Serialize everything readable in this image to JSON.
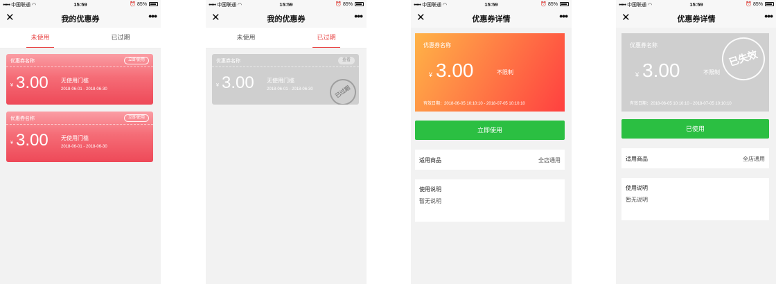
{
  "status_bar": {
    "carrier": "中国联通",
    "time": "15:59",
    "battery": "85%"
  },
  "screens": [
    {
      "nav_title": "我的优惠券",
      "tabs": [
        "未使用",
        "已过期"
      ],
      "active_tab": 0,
      "coupons": [
        {
          "name": "优惠券名称",
          "button": "立即使用",
          "currency": "¥",
          "amount": "3.00",
          "condition": "无使用门槛",
          "dates": "2018-06-01 - 2018-06-30"
        },
        {
          "name": "优惠券名称",
          "button": "立即使用",
          "currency": "¥",
          "amount": "3.00",
          "condition": "无使用门槛",
          "dates": "2018-06-01 - 2018-06-30"
        }
      ]
    },
    {
      "nav_title": "我的优惠券",
      "tabs": [
        "未使用",
        "已过期"
      ],
      "active_tab": 1,
      "coupons": [
        {
          "name": "优惠券名称",
          "button": "查看",
          "currency": "¥",
          "amount": "3.00",
          "condition": "无使用门槛",
          "dates": "2018-06-01 - 2018-06-30",
          "stamp": "已过期"
        }
      ]
    },
    {
      "nav_title": "优惠券详情",
      "card": {
        "name": "优惠券名称",
        "currency": "¥",
        "amount": "3.00",
        "condition": "不限制",
        "validity": "有效日期：2018-06-05 10:10:10 - 2018-07-05 10:10:10"
      },
      "action_button": "立即使用",
      "goods_label": "适用商品",
      "goods_value": "全店通用",
      "desc_label": "使用说明",
      "desc_value": "暂无说明"
    },
    {
      "nav_title": "优惠券详情",
      "card": {
        "name": "优惠券名称",
        "currency": "¥",
        "amount": "3.00",
        "condition": "不限制",
        "validity": "有效日期：2018-06-05 10:10:10 - 2018-07-05 10:10:10",
        "stamp": "已失效"
      },
      "action_button": "已使用",
      "goods_label": "适用商品",
      "goods_value": "全店通用",
      "desc_label": "使用说明",
      "desc_value": "暂无说明"
    }
  ],
  "icons": {
    "close": "close-icon",
    "more": "more-icon",
    "signal": "signal-icon",
    "wifi": "wifi-icon",
    "alarm": "alarm-icon",
    "battery": "battery-icon"
  },
  "colors": {
    "accent_red": "#e84545",
    "coupon_red": "#f56d77",
    "detail_orange": "#ff7a45",
    "green_button": "#2bbf42",
    "expired_grey": "#cfcfcf"
  }
}
